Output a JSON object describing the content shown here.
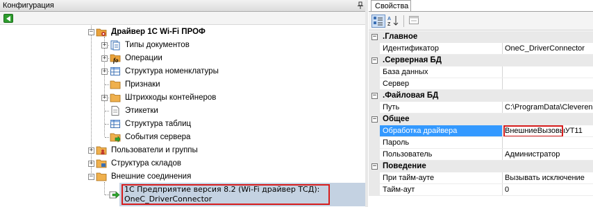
{
  "config_panel": {
    "title": "Конфигурация",
    "pin_icon": "pin-icon",
    "back_icon": "back-arrow-icon"
  },
  "tree": {
    "root": {
      "label": "Драйвер 1С Wi-Fi ПРОФ",
      "icon": "folder-gear-icon"
    },
    "children": [
      {
        "label": "Типы документов",
        "icon": "documents-icon",
        "expandable": true
      },
      {
        "label": "Операции",
        "icon": "function-icon",
        "expandable": true
      },
      {
        "label": "Структура номенклатуры",
        "icon": "table-icon",
        "expandable": true
      },
      {
        "label": "Признаки",
        "icon": "folder-icon",
        "expandable": false
      },
      {
        "label": "Штрихкоды контейнеров",
        "icon": "folder-icon",
        "expandable": true
      },
      {
        "label": "Этикетки",
        "icon": "page-icon",
        "expandable": false
      },
      {
        "label": "Структура таблиц",
        "icon": "table-icon",
        "expandable": false
      },
      {
        "label": "События сервера",
        "icon": "folder-event-icon",
        "expandable": false
      }
    ],
    "top_level": [
      {
        "label": "Пользователи и группы",
        "icon": "users-icon",
        "expander": "+"
      },
      {
        "label": "Структура складов",
        "icon": "warehouse-icon",
        "expander": "+"
      },
      {
        "label": "Внешние соединения",
        "icon": "folder-icon",
        "expander": "−"
      }
    ],
    "selected_connection": {
      "line1": "1С Предприятие версия 8.2 (Wi-Fi драйвер ТСД):",
      "line2": "OneC_DriverConnector",
      "icon": "connection-arrow-icon"
    }
  },
  "properties_panel": {
    "tab_label": "Свойства",
    "toolbar": {
      "categorized_icon": "categorized-icon",
      "alphabetical_icon": "sort-az-icon",
      "pages_icon": "property-pages-icon"
    },
    "categories": [
      {
        "label": ".Главное",
        "rows": [
          {
            "name": "Идентификатор",
            "value": "OneC_DriverConnector"
          }
        ]
      },
      {
        "label": ".Серверная БД",
        "rows": [
          {
            "name": "База данных",
            "value": ""
          },
          {
            "name": "Сервер",
            "value": ""
          }
        ]
      },
      {
        "label": ".Файловая БД",
        "rows": [
          {
            "name": "Путь",
            "value": "C:\\ProgramData\\Cleverence"
          }
        ]
      },
      {
        "label": "Общее",
        "rows": [
          {
            "name": "Обработка драйвера",
            "value": "ВнешниеВызовыУТ11",
            "selected": true
          },
          {
            "name": "Пароль",
            "value": ""
          },
          {
            "name": "Пользователь",
            "value": "Администратор"
          }
        ]
      },
      {
        "label": "Поведение",
        "rows": [
          {
            "name": "При тайм-ауте",
            "value": "Вызывать исключение"
          },
          {
            "name": "Тайм-аут",
            "value": "0"
          }
        ]
      }
    ],
    "colors": {
      "selection": "#3399ff",
      "highlight_frame": "#d61c1c",
      "tree_selection": "#c4d2e2"
    }
  }
}
